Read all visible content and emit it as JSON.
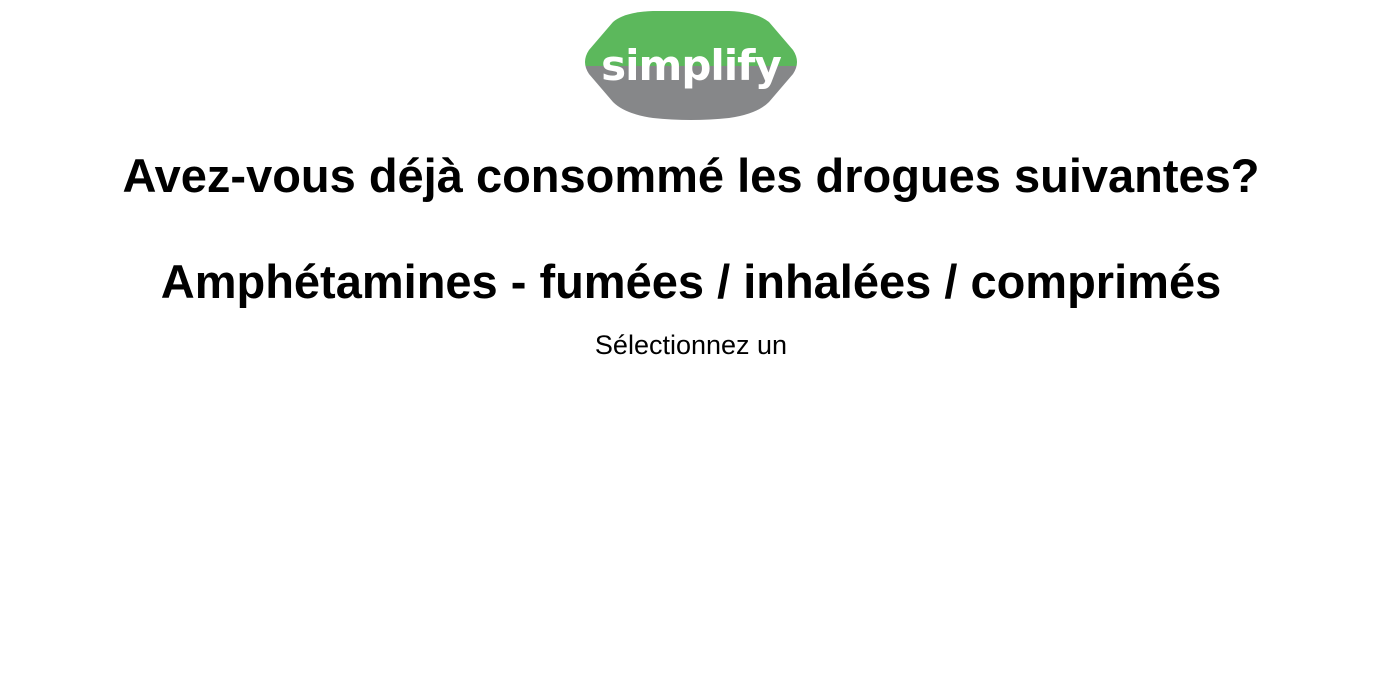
{
  "logo": {
    "text": "simplify",
    "colors": {
      "top": "#5cb85c",
      "bottom": "#868789",
      "text": "#ffffff"
    }
  },
  "survey": {
    "question": "Avez-vous déjà consommé les drogues suivantes?",
    "item": "Amphétamines - fumées / inhalées / comprimés",
    "instruction": "Sélectionnez un"
  }
}
